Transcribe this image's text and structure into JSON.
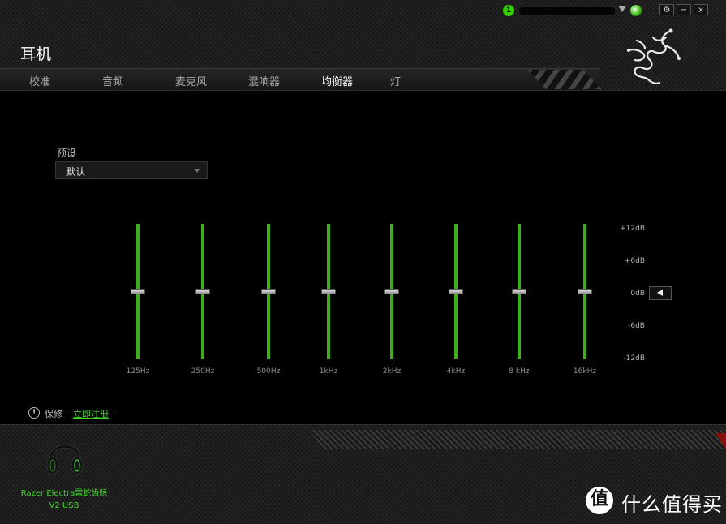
{
  "window": {
    "title": "耳机",
    "notification_count": "1",
    "buttons": {
      "settings": "⚙",
      "minimize": "−",
      "close": "x"
    }
  },
  "tabs": [
    {
      "label": "校准",
      "active": false
    },
    {
      "label": "音频",
      "active": false
    },
    {
      "label": "麦克风",
      "active": false
    },
    {
      "label": "混响器",
      "active": false
    },
    {
      "label": "均衡器",
      "active": true
    },
    {
      "label": "灯",
      "active": false
    }
  ],
  "equalizer": {
    "preset_label": "预设",
    "preset_value": "默认",
    "bands": [
      {
        "label": "125Hz",
        "gain_db": 0
      },
      {
        "label": "250Hz",
        "gain_db": 0
      },
      {
        "label": "500Hz",
        "gain_db": 0
      },
      {
        "label": "1kHz",
        "gain_db": 0
      },
      {
        "label": "2kHz",
        "gain_db": 0
      },
      {
        "label": "4kHz",
        "gain_db": 0
      },
      {
        "label": "8 kHz",
        "gain_db": 0
      },
      {
        "label": "16kHz",
        "gain_db": 0
      }
    ],
    "range_db": [
      -12,
      12
    ],
    "db_labels": [
      "+12dB",
      "+6dB",
      "0dB",
      "-6dB",
      "-12dB"
    ]
  },
  "footer": {
    "warranty_label": "保修",
    "register_link": "立即注册",
    "device_name_line1": "Razer Electra雷蛇齿鲸",
    "device_name_line2": "V2 USB"
  },
  "watermark": {
    "badge": "值",
    "text": "什么值得买"
  },
  "colors": {
    "accent": "#44d62c",
    "track": "#3fae1a",
    "background": "#000000"
  }
}
